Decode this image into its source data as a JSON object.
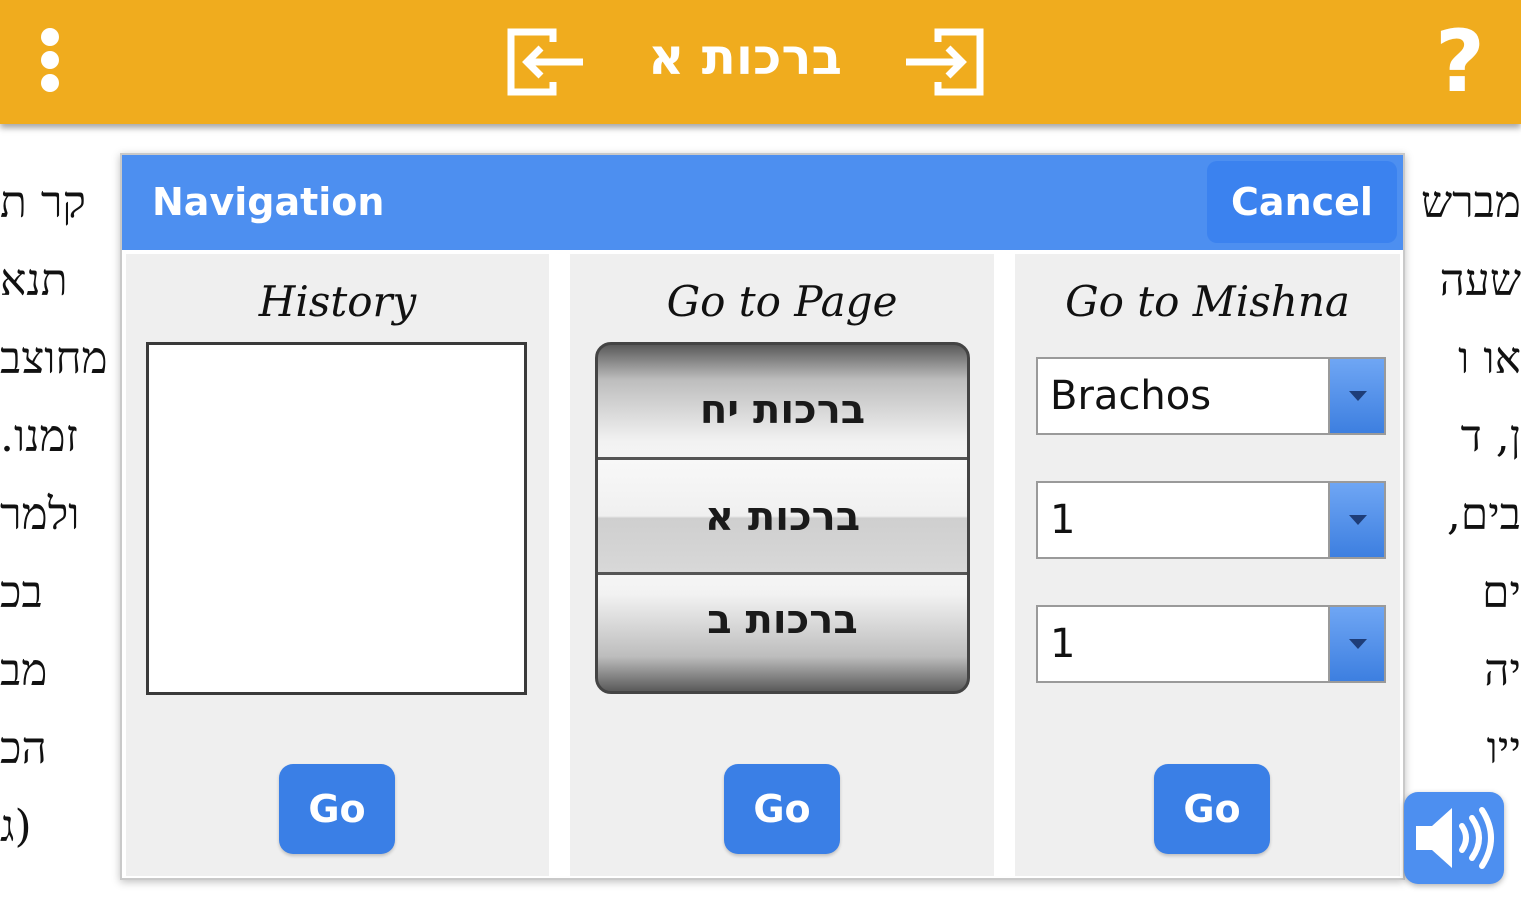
{
  "topbar": {
    "title": "ברכות א",
    "help_label": "?"
  },
  "background_text": {
    "left_lines": [
      "קר ת",
      "תנא",
      "מחוצב",
      "זמנו.",
      "ולמר",
      "בכ",
      "מב",
      "הכ",
      "(ג"
    ],
    "right_lines": [
      "מברש",
      "שעה",
      "או ו",
      "ן, ד",
      "בים,",
      "ים",
      "יה",
      "ייו",
      ""
    ]
  },
  "dialog": {
    "title": "Navigation",
    "cancel_label": "Cancel",
    "history": {
      "heading": "History",
      "go_label": "Go"
    },
    "page": {
      "heading": "Go to Page",
      "picker_prev": "ברכות יח",
      "picker_selected": "ברכות א",
      "picker_next": "ברכות ב",
      "go_label": "Go"
    },
    "mishna": {
      "heading": "Go to Mishna",
      "book_value": "Brachos",
      "chapter_value": "1",
      "mishna_value": "1",
      "go_label": "Go"
    }
  },
  "colors": {
    "topbar": "#f0ac1e",
    "dialog_header": "#4d8ff0",
    "button": "#3a7fe6"
  },
  "icons": [
    "menu-dots-icon",
    "prev-page-icon",
    "next-page-icon",
    "help-icon",
    "speaker-icon",
    "dropdown-arrow-icon"
  ]
}
